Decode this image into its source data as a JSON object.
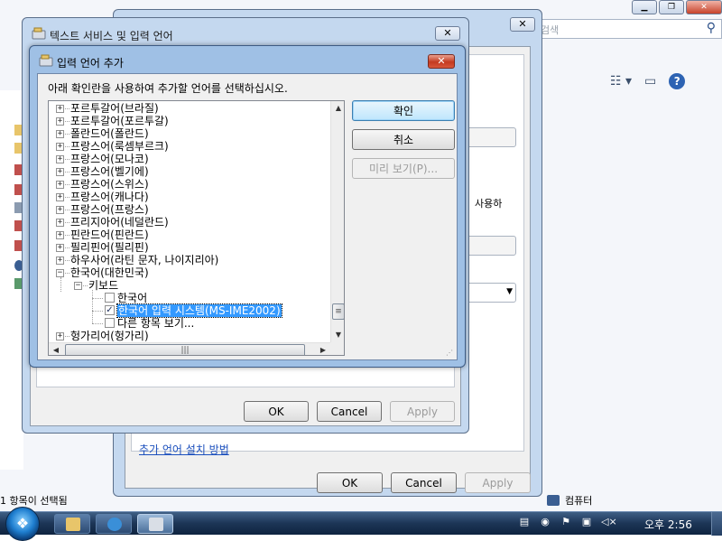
{
  "explorer": {
    "search_placeholder": "검색",
    "status_left": "1 항목이 선택됨",
    "status_right": "컴퓨터"
  },
  "region_dialog": {
    "close_glyph": "✕",
    "fragment_using": "사용하",
    "install_link": "추가 언어 설치 방법",
    "buttons": {
      "ok": "OK",
      "cancel": "Cancel",
      "apply": "Apply"
    }
  },
  "text_services_dialog": {
    "title": "텍스트 서비스 및 입력 언어",
    "close_glyph": "✕",
    "buttons": {
      "ok": "OK",
      "cancel": "Cancel",
      "apply": "Apply"
    }
  },
  "add_language_dialog": {
    "title": "입력 언어 추가",
    "close_glyph": "✕",
    "instruction": "아래 확인란을 사용하여 추가할 언어를 선택하십시오.",
    "buttons": {
      "ok": "확인",
      "cancel": "취소",
      "preview": "미리 보기(P)..."
    },
    "tree": [
      {
        "label": "포르투갈어(브라질)",
        "level": 0,
        "expander": "+"
      },
      {
        "label": "포르투갈어(포르투갈)",
        "level": 0,
        "expander": "+"
      },
      {
        "label": "폴란드어(폴란드)",
        "level": 0,
        "expander": "+"
      },
      {
        "label": "프랑스어(룩셈부르크)",
        "level": 0,
        "expander": "+"
      },
      {
        "label": "프랑스어(모나코)",
        "level": 0,
        "expander": "+"
      },
      {
        "label": "프랑스어(벨기에)",
        "level": 0,
        "expander": "+"
      },
      {
        "label": "프랑스어(스위스)",
        "level": 0,
        "expander": "+"
      },
      {
        "label": "프랑스어(캐나다)",
        "level": 0,
        "expander": "+"
      },
      {
        "label": "프랑스어(프랑스)",
        "level": 0,
        "expander": "+"
      },
      {
        "label": "프리지아어(네덜란드)",
        "level": 0,
        "expander": "+"
      },
      {
        "label": "핀란드어(핀란드)",
        "level": 0,
        "expander": "+"
      },
      {
        "label": "필리핀어(필리핀)",
        "level": 0,
        "expander": "+"
      },
      {
        "label": "하우사어(라틴 문자, 나이지리아)",
        "level": 0,
        "expander": "+"
      },
      {
        "label": "한국어(대한민국)",
        "level": 0,
        "expander": "−"
      },
      {
        "label": "키보드",
        "level": 1,
        "expander": "−"
      },
      {
        "label": "한국어",
        "level": 2,
        "checkbox": true,
        "checked": false
      },
      {
        "label": "한국어 입력 시스템(MS-IME2002)",
        "level": 2,
        "checkbox": true,
        "checked": true,
        "selected": true
      },
      {
        "label": "다른 항목 보기...",
        "level": 2,
        "checkbox": true,
        "checked": false
      },
      {
        "label": "헝가리어(헝가리)",
        "level": 0,
        "expander": "+"
      }
    ]
  },
  "taskbar": {
    "clock": "오후 2:56",
    "start_glyph": "❖"
  },
  "colors": {
    "selection": "#3399ff",
    "dialog_frame": "#9fc0e5",
    "taskbar": "#1c3556",
    "close_red": "#c43a20"
  }
}
